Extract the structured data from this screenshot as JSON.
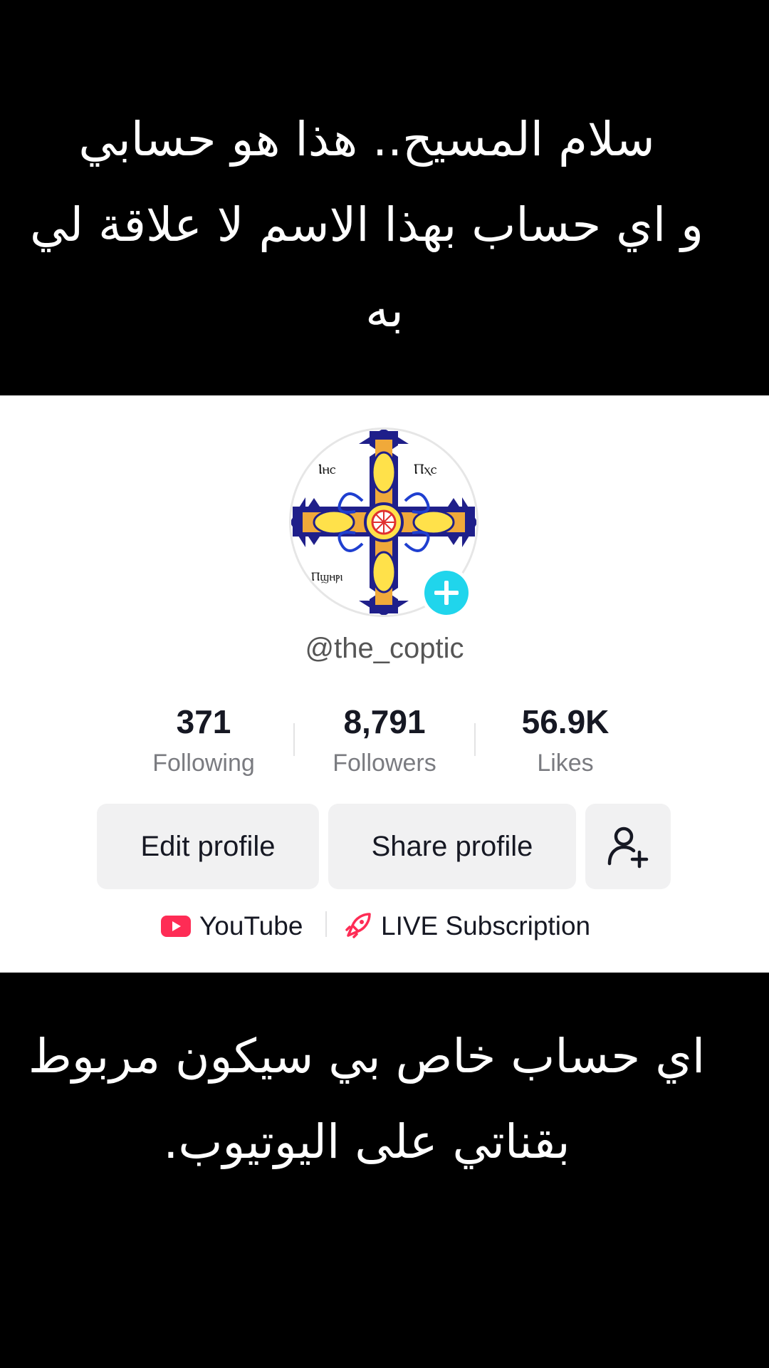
{
  "top_caption": {
    "line1": "سلام المسيح.. هذا هو حسابي",
    "line2": "و اي حساب بهذا الاسم لا علاقة لي",
    "line3": "به"
  },
  "profile": {
    "avatar_texts": [
      "Ⲓⲏⲥ",
      "Ⲡⲭⲥ",
      "Ⲡϣⲏⲣⲓ"
    ],
    "username": "@the_coptic",
    "stats": [
      {
        "value": "371",
        "label": "Following"
      },
      {
        "value": "8,791",
        "label": "Followers"
      },
      {
        "value": "56.9K",
        "label": "Likes"
      }
    ],
    "buttons": {
      "edit": "Edit profile",
      "share": "Share profile"
    },
    "links": {
      "youtube": "YouTube",
      "live": "LIVE Subscription"
    },
    "colors": {
      "accent": "#20d5ec",
      "youtube_red": "#fe2c55"
    }
  },
  "bottom_caption": {
    "line1": "اي حساب خاص بي سيكون مربوط",
    "line2": "بقناتي على اليوتيوب."
  }
}
